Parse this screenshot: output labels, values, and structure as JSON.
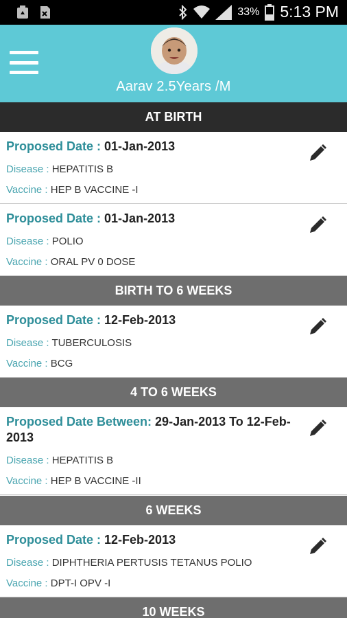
{
  "status_bar": {
    "battery": "33%",
    "time": "5:13 PM",
    "icons": [
      "recycle-notification-icon",
      "sd-card-icon",
      "bluetooth-icon",
      "wifi-icon",
      "signal-icon",
      "battery-icon"
    ]
  },
  "header": {
    "child_name": "Aarav 2.5Years /M",
    "menu_icon": "hamburger-menu-icon",
    "background": "#5ec9d6"
  },
  "labels": {
    "proposed_date": "Proposed Date : ",
    "proposed_date_between": "Proposed Date Between: ",
    "disease": "Disease : ",
    "vaccine": "Vaccine : "
  },
  "sections": [
    {
      "title": "AT BIRTH",
      "items": [
        {
          "date": "01-Jan-2013",
          "disease": "HEPATITIS B",
          "vaccine": "HEP B VACCINE -I"
        },
        {
          "date": "01-Jan-2013",
          "disease": "POLIO",
          "vaccine": "ORAL PV 0 DOSE"
        }
      ]
    },
    {
      "title": "BIRTH TO 6 WEEKS",
      "items": [
        {
          "date": "12-Feb-2013",
          "disease": "TUBERCULOSIS",
          "vaccine": "BCG"
        }
      ]
    },
    {
      "title": "4 TO 6 WEEKS",
      "items": [
        {
          "date": "29-Jan-2013 To 12-Feb-2013",
          "disease": "HEPATITIS B",
          "vaccine": "HEP B VACCINE -II"
        }
      ]
    },
    {
      "title": "6 WEEKS",
      "items": [
        {
          "date": "12-Feb-2013",
          "disease": "DIPHTHERIA PERTUSIS TETANUS POLIO",
          "vaccine": "DPT-I OPV -I"
        }
      ]
    },
    {
      "title": "10 WEEKS",
      "items": []
    }
  ],
  "colors": {
    "accent": "#5ec9d6",
    "label_teal": "#2e8e99",
    "section_dark": "#2b2b2b",
    "section_gray": "#6e6e6e"
  }
}
